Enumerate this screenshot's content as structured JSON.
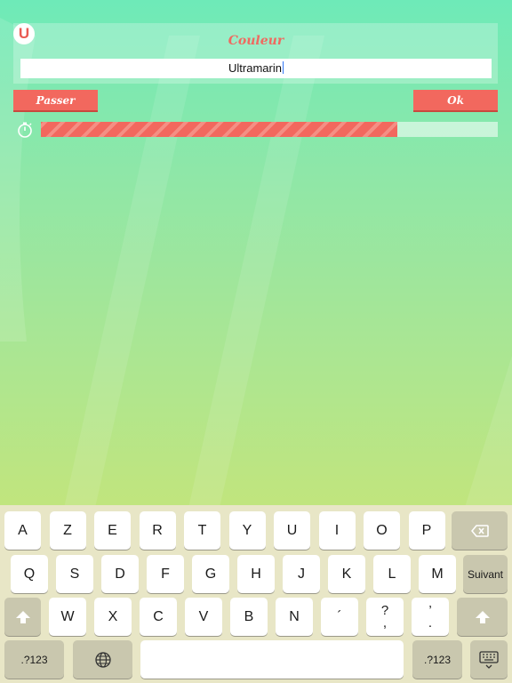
{
  "app": {
    "logo_letter": "U",
    "title": "Couleur",
    "answer_value": "Ultramarin",
    "skip_label": "Passer",
    "ok_label": "Ok",
    "timer_icon": "stopwatch-icon",
    "time_remaining_fraction": 0.78,
    "accent_color": "#f2685e"
  },
  "keyboard": {
    "row1": [
      "A",
      "Z",
      "E",
      "R",
      "T",
      "Y",
      "U",
      "I",
      "O",
      "P"
    ],
    "row2": [
      "Q",
      "S",
      "D",
      "F",
      "G",
      "H",
      "J",
      "K",
      "L",
      "M"
    ],
    "row3": [
      "W",
      "X",
      "C",
      "V",
      "B",
      "N",
      "´"
    ],
    "row3_dual": [
      {
        "top": "?",
        "bottom": ","
      },
      {
        "top": "’",
        "bottom": "."
      }
    ],
    "return_label": "Suivant",
    "numbers_label": ".?123",
    "icons": [
      "backspace-icon",
      "shift-icon",
      "globe-icon",
      "keyboard-dismiss-icon"
    ]
  }
}
